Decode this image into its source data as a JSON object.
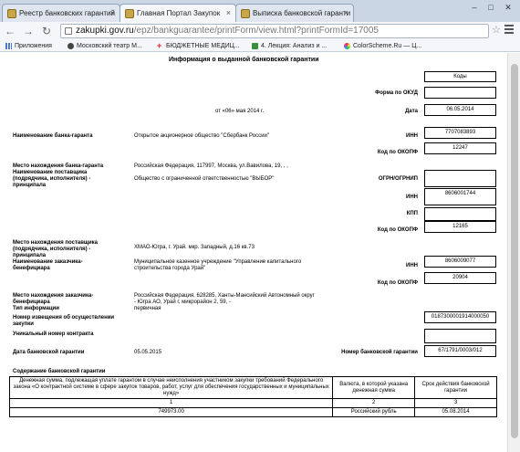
{
  "browser": {
    "tabs": [
      {
        "label": "Реестр банковских гарантий"
      },
      {
        "label": "Главная Портал Закупок"
      },
      {
        "label": "Выписка банковской гаранти"
      }
    ],
    "close_glyph": "×",
    "url_host": "zakupki.gov.ru",
    "url_rest": "/epz/bankguarantee/printForm/view.html?printFormId=17005",
    "bookmarks": [
      {
        "label": "Приложения",
        "icon": "apps-icon"
      },
      {
        "label": "Московский театр М...",
        "icon": "theatre-icon"
      },
      {
        "label": "БЮДЖЕТНЫЕ МЕДИЦ...",
        "icon": "red-cross-icon"
      },
      {
        "label": "4. Лекция: Анализ и ...",
        "icon": "lecture-icon"
      },
      {
        "label": "ColorScheme.Ru — Ц...",
        "icon": "palette-icon"
      }
    ],
    "accent_color": "#cbd6e5"
  },
  "document": {
    "title": "Информация о выданной банковской гарантии",
    "codes_header": "Коды",
    "okud_label": "Форма по ОКУД",
    "date_text": "от «06» мая 2014 г.",
    "date_label": "Дата",
    "date_code": "06.05.2014",
    "bank_name_label": "Наименование банка-гаранта",
    "bank_name_value": "Открытое акционерное общество \"Сбербанк России\"",
    "inn_label": "ИНН",
    "bank_inn": "7707083893",
    "okopf_label": "Код по ОКОПФ",
    "bank_okopf": "12247",
    "bank_location_label": "Место нахождения банка-гаранта",
    "bank_location_value": "Российская Федерация, 117997, Москва, ул.Вавилова, 19, , ,",
    "supplier_name_label": "Наименование поставщика (подрядчика, исполнителя) - принципала",
    "supplier_name_value": "Общество с ограниченной ответственностью \"ВЫБОР\"",
    "ogrn_label": "ОГРН/ОГРНИП",
    "supplier_inn": "8606001744",
    "kpp_label": "КПП",
    "supplier_okopf": "12165",
    "supplier_location_label": "Место нахождения поставщика (подрядчика, исполнителя) - принципала",
    "supplier_location_value": "ХМАО-Югра, г. Урай. мкр. Западный, д.16 кв.73",
    "customer_name_label": "Наименование заказчика-бенефициара",
    "customer_name_value": "Муниципальное казенное учреждение \"Управление капитального строительства города Урай\"",
    "customer_inn": "8606009077",
    "customer_okopf": "20904",
    "customer_location_label": "Место нахождения заказчика-бенефициара",
    "customer_location_value": "Российская Федерация, 628285, Ханты-Мансийский Автономный округ - Югра АО, Урай г, микрорайон 2, 59, -",
    "info_type_label": "Тип информации",
    "info_type_value": "первичная",
    "notice_number_label": "Номер извещения об осуществлении закупки",
    "notice_number": "0187300001914000050",
    "contract_number_label": "Уникальный номер контракта",
    "guarantee_date_label": "Дата банковской гарантии",
    "guarantee_date": "05.05.2015",
    "guarantee_number_label": "Номер банковской гарантии",
    "guarantee_number": "67/1791/0003/012",
    "content_label": "Содержание банковской гарантии",
    "table": {
      "headers": [
        "Денежная сумма, подлежащая уплате гарантом в случае неисполнения участником закупки требований Федерального закона «О контрактной системе в сфере закупок товаров, работ, услуг для обеспечения государственных и муниципальных нужд»",
        "Валюта, в которой указана денежная сумма",
        "Срок действия банковской гарантии"
      ],
      "numbers": [
        "1",
        "2",
        "3"
      ],
      "row": [
        "749973.00",
        "Российский рубль",
        "05.08.2014"
      ]
    }
  }
}
